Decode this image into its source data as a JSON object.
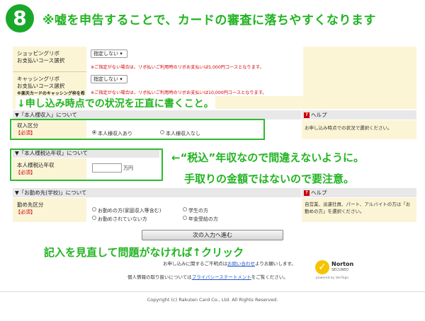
{
  "step_number": "8",
  "headline": "※嘘を申告することで、カードの審査に落ちやすくなります",
  "shopping": {
    "label1": "ショッピングリボ",
    "label2": "お支払いコース選択",
    "select": "指定しない",
    "note": "※ご指定がない場合は、リボ払いご利用時のリボお支払いは5,000円コースとなります。"
  },
  "cashing": {
    "label1": "キャッシングリボ",
    "label2": "お支払いコース選択",
    "label3": "※楽天カードのキャッシング枠を希",
    "select": "指定しない",
    "note": "※ご指定がない場合は、リボ払いご利用時のリボお支払いは10,000円コースとなります。"
  },
  "overlay1": "↓申し込み時点での状況を正直に書くこと。",
  "income": {
    "section": "▼「本人様収入」について",
    "help_title": "ヘルプ",
    "label": "収入区分",
    "required": "【必須】",
    "opt1": "本人様収入あり",
    "opt2": "本人様収入なし",
    "help_text": "お申し込み時点での状況で選択ください。"
  },
  "taxed": {
    "section": "▼「本人様税込年収」について",
    "label": "本人様税込年収",
    "required": "【必須】",
    "unit": "万円"
  },
  "overlay2": "←“税込”年収なので間違えないように。",
  "overlay3": "手取りの金額ではないので要注意。",
  "work": {
    "section": "▼「お勤め先(学校)」について",
    "help_title": "ヘルプ",
    "label": "勤め先区分",
    "required": "【必須】",
    "opt1": "お勤めの方(家庭収入等含む)",
    "opt2": "学生の方",
    "opt3": "お勤めされていない方",
    "opt4": "年金受給の方",
    "help_text": "自営業、派遣社員、パート、アルバイトの方は「お勤めの方」を選択ください。"
  },
  "next_button": "次の入力へ進む",
  "overlay4": "記入を見直して問題がなければ↑クリック",
  "inquiry_prefix": "お申し込みに関するご不明点は",
  "inquiry_link": "お問い合わせ",
  "inquiry_suffix": "よりお願いします。",
  "privacy_prefix": "個人情報の取り扱いについては",
  "privacy_link": "プライバシーステートメント",
  "privacy_suffix": "をご覧ください。",
  "norton": {
    "name": "Norton",
    "secured": "SECURED",
    "powered": "powered by VeriSign"
  },
  "copyright": "Copyright (c) Rakuten Card Co., Ltd. All Rights Reserved."
}
